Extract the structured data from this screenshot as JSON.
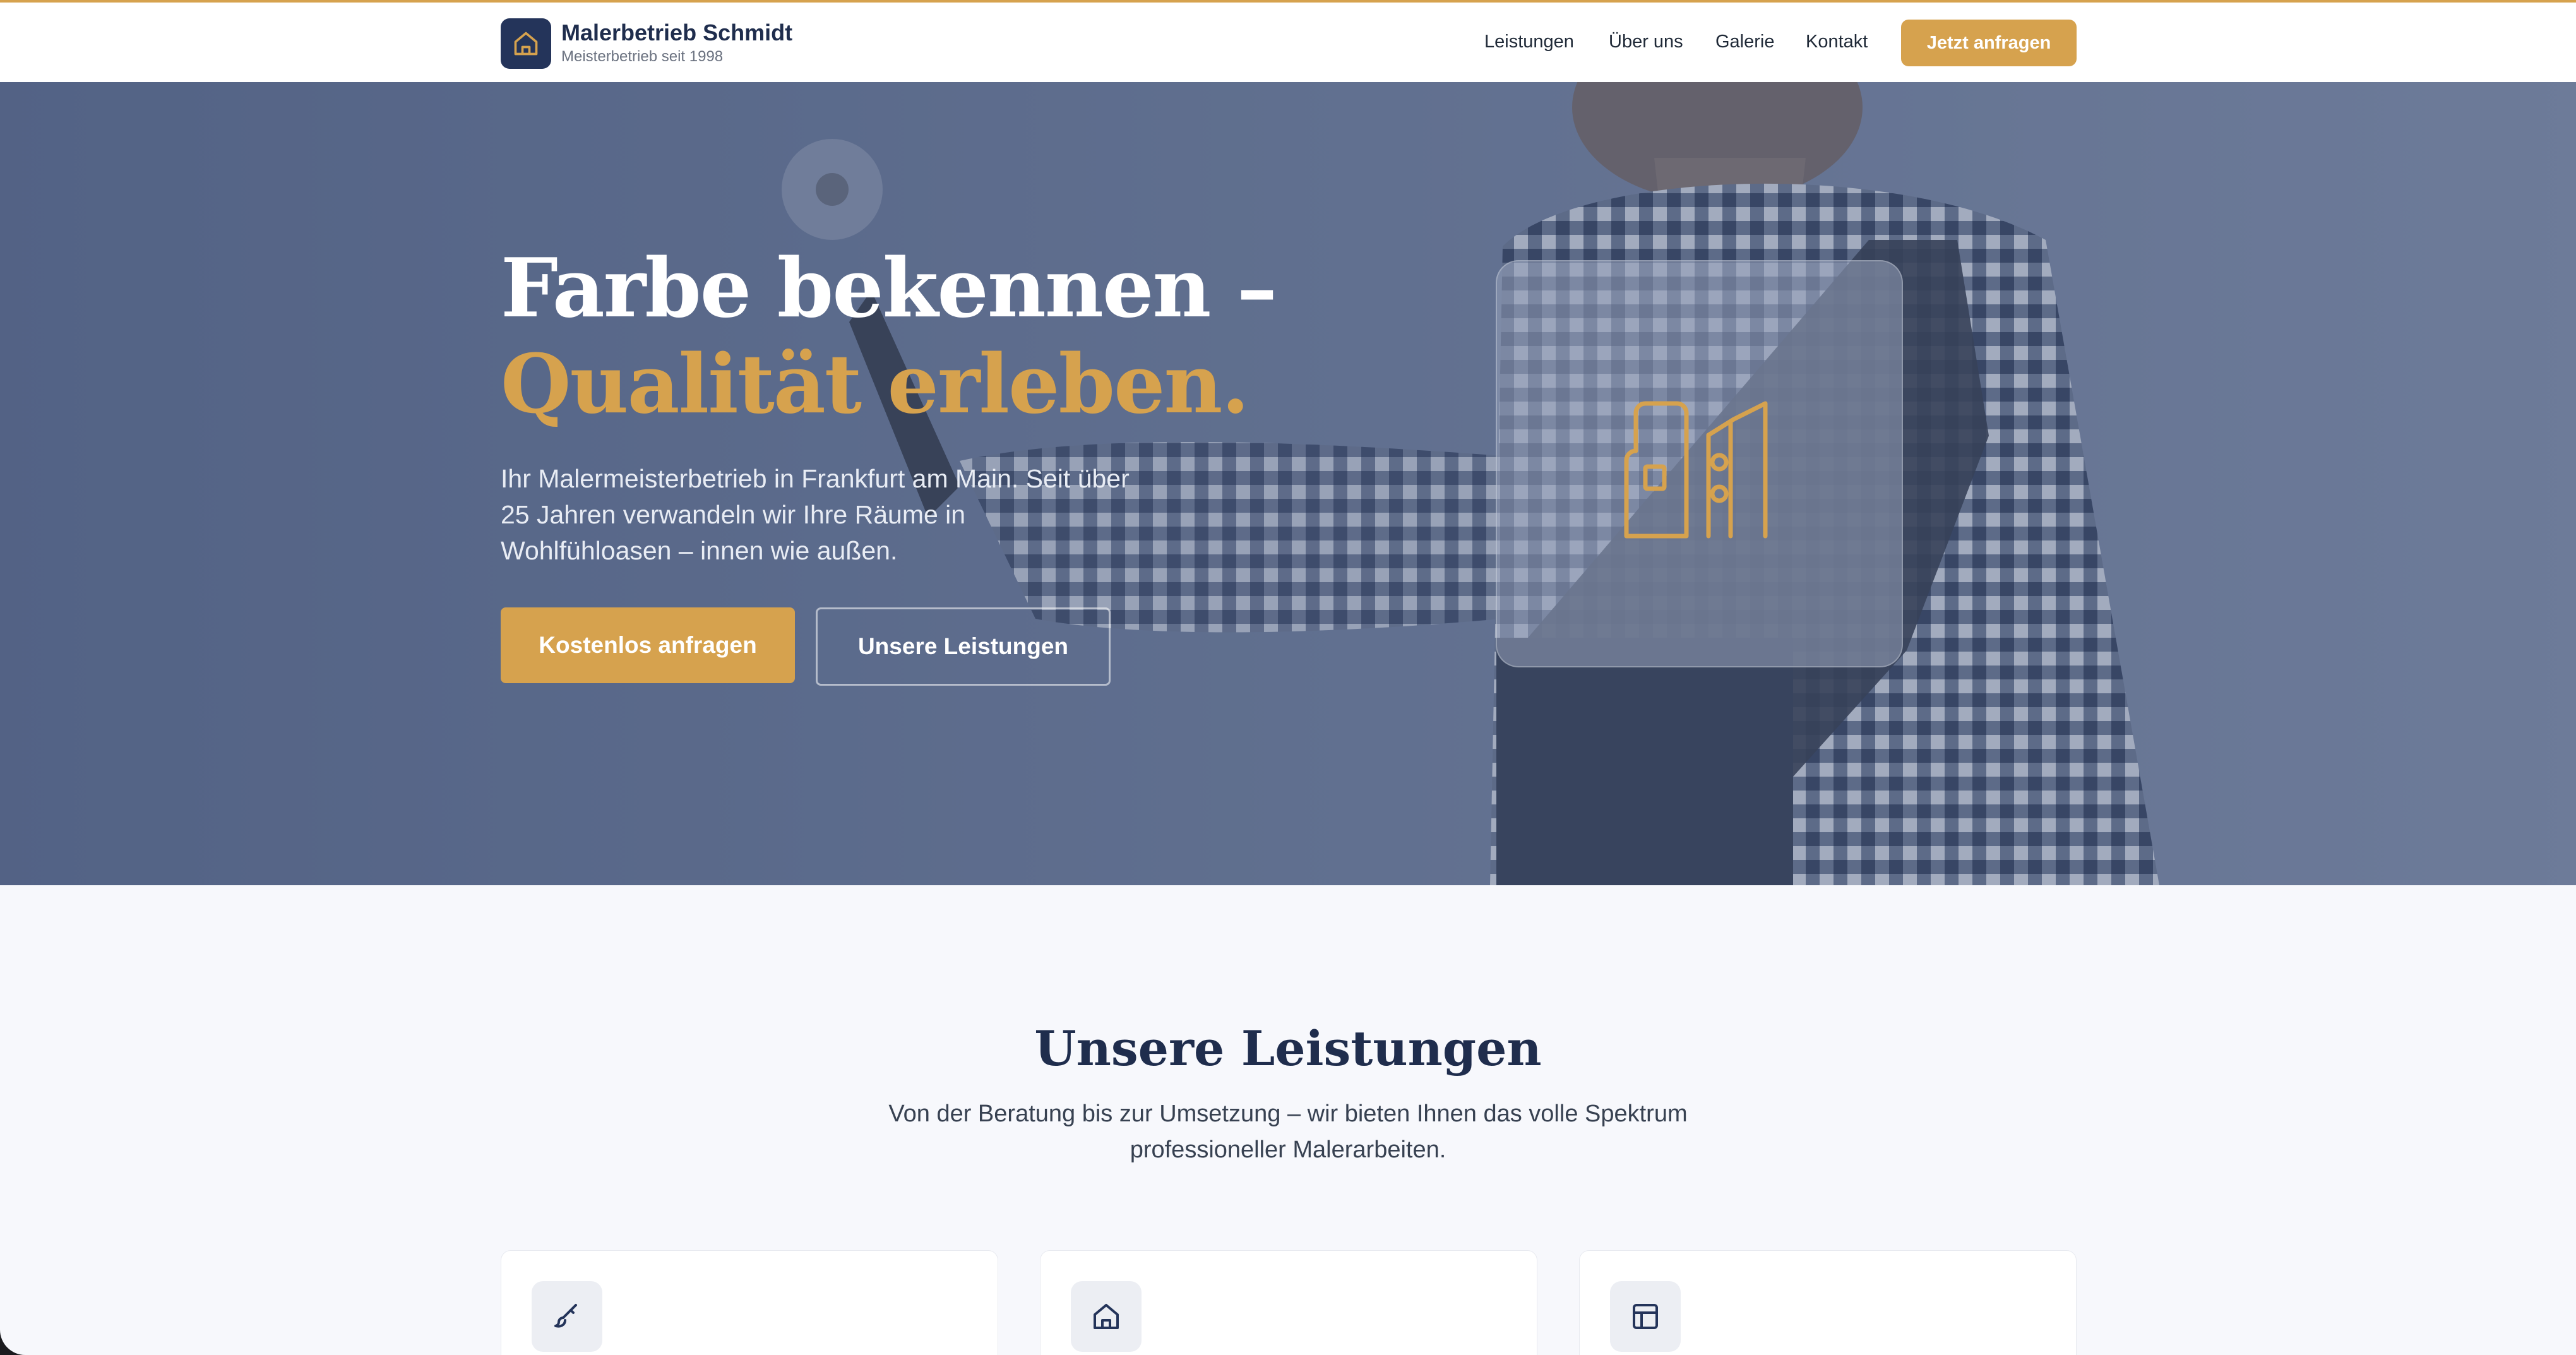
{
  "brand": {
    "name": "Malerbetrieb Schmidt",
    "tagline": "Meisterbetrieb seit 1998"
  },
  "nav": {
    "items": [
      "Leistungen",
      "Über uns",
      "Galerie",
      "Kontakt"
    ],
    "cta": "Jetzt anfragen"
  },
  "hero": {
    "title_line1": "Farbe bekennen –",
    "title_line2": "Qualität erleben.",
    "text": "Ihr Malermeisterbetrieb in Frankfurt am Main. Seit über 25 Jahren verwandeln wir Ihre Räume in Wohlfühloasen – innen wie außen.",
    "btn_primary": "Kostenlos anfragen",
    "btn_secondary": "Unsere Leistungen"
  },
  "services": {
    "title": "Unsere Leistungen",
    "subtitle": "Von der Beratung bis zur Umsetzung – wir bieten Ihnen das volle Spektrum professioneller Malerarbeiten.",
    "cards": [
      {
        "icon": "brush-icon"
      },
      {
        "icon": "home-icon"
      },
      {
        "icon": "layout-icon"
      }
    ]
  },
  "colors": {
    "accent": "#d6a24e",
    "navy": "#1f2d4d",
    "hero_overlay": "#58688c",
    "background": "#f7f8fc"
  }
}
